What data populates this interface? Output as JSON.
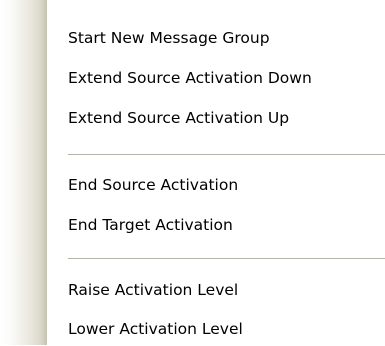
{
  "menu": {
    "items": [
      {
        "label": "Start New Message Group"
      },
      {
        "label": "Extend Source Activation Down"
      },
      {
        "label": "Extend Source Activation Up"
      },
      {
        "label": "End Source Activation"
      },
      {
        "label": "End Target Activation"
      },
      {
        "label": "Raise Activation Level"
      },
      {
        "label": "Lower Activation Level"
      }
    ]
  }
}
